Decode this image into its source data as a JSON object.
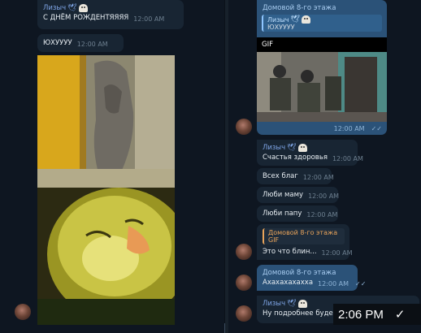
{
  "left": {
    "messages": [
      {
        "sender": "Лизыч",
        "text": "С ДНЁМ РОЖДЕНТЯЯЯЯ",
        "time": "12:00 AM"
      },
      {
        "text": "ЮХУУУУ",
        "time": "12:00 AM"
      }
    ]
  },
  "right": {
    "gif_post": {
      "sender": "Домовой 8-го этажа",
      "reply_sender": "Лизыч",
      "reply_text": "ЮХУУУУ",
      "label": "GIF",
      "time": "12:00 AM"
    },
    "messages": [
      {
        "sender": "Лизыч",
        "text": "Счастья здоровья",
        "time": "12:00 AM"
      },
      {
        "text": "Всех благ",
        "time": "12:00 AM"
      },
      {
        "text": "Люби маму",
        "time": "12:00 AM"
      },
      {
        "text": "Люби папу",
        "time": "12:00 AM"
      },
      {
        "reply_sender": "Домовой 8-го этажа",
        "reply_text": "GIF",
        "text": "Это что блин...",
        "time": "12:00 AM"
      }
    ],
    "outgoing_last": {
      "sender": "Домовой 8-го этажа",
      "text": "Ахахахахахха",
      "time": "12:00 AM"
    },
    "last": {
      "sender": "Лизыч",
      "text": "Ну подробнее будет зав"
    }
  },
  "status": {
    "clock": "2:06 PM"
  },
  "colors": {
    "background": "#0e1621",
    "bubble_in": "#182533",
    "bubble_out": "#2b5278",
    "accent_blue": "#7ea5e6",
    "accent_orange": "#e9a45a"
  }
}
